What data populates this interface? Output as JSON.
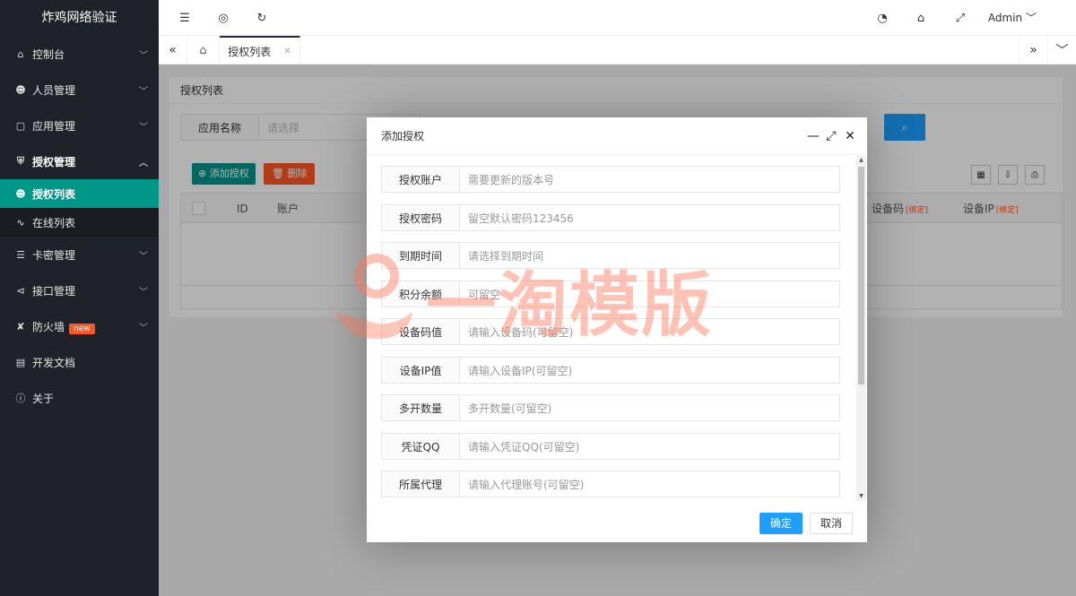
{
  "app": {
    "title": "炸鸡网络验证"
  },
  "sidebar": {
    "items": [
      {
        "label": "控制台",
        "icon": "home-icon"
      },
      {
        "label": "人员管理",
        "icon": "user-icon"
      },
      {
        "label": "应用管理",
        "icon": "cube-icon"
      },
      {
        "label": "授权管理",
        "icon": "shield-icon"
      },
      {
        "label": "卡密管理",
        "icon": "layers-icon"
      },
      {
        "label": "接口管理",
        "icon": "share-icon"
      },
      {
        "label": "防火墙",
        "icon": "firewall-icon",
        "badge": "new"
      },
      {
        "label": "开发文档",
        "icon": "book-icon"
      },
      {
        "label": "关于",
        "icon": "info-icon"
      }
    ],
    "sub_items": [
      {
        "label": "授权列表",
        "icon": "user-icon"
      },
      {
        "label": "在线列表",
        "icon": "pulse-icon"
      }
    ]
  },
  "header": {
    "user": "Admin"
  },
  "tabs": {
    "active": "授权列表"
  },
  "main": {
    "card_title": "授权列表",
    "search": {
      "label": "应用名称",
      "placeholder": "请选择"
    },
    "buttons": {
      "add": "添加授权",
      "delete": "删除"
    },
    "table": {
      "columns": [
        "ID",
        "账户",
        "设备码",
        "设备IP"
      ],
      "bind_tag": "[绑定]"
    }
  },
  "watermark": "一淘模版",
  "modal": {
    "title": "添加授权",
    "fields": [
      {
        "label": "授权账户",
        "placeholder": "需要更新的版本号"
      },
      {
        "label": "授权密码",
        "placeholder": "留空默认密码123456"
      },
      {
        "label": "到期时间",
        "placeholder": "请选择到期时间"
      },
      {
        "label": "积分余额",
        "placeholder": "可留空"
      },
      {
        "label": "设备码值",
        "placeholder": "请输入设备码(可留空)"
      },
      {
        "label": "设备IP值",
        "placeholder": "请输入设备IP(可留空)"
      },
      {
        "label": "多开数量",
        "placeholder": "多开数量(可留空)"
      },
      {
        "label": "凭证QQ",
        "placeholder": "请输入凭证QQ(可留空)"
      },
      {
        "label": "所属代理",
        "placeholder": "请输入代理账号(可留空)"
      }
    ],
    "ok": "确定",
    "cancel": "取消"
  },
  "colors": {
    "primary": "#009688",
    "blue": "#1e9fff",
    "danger": "#ff5722",
    "sidebar": "#20222a"
  }
}
